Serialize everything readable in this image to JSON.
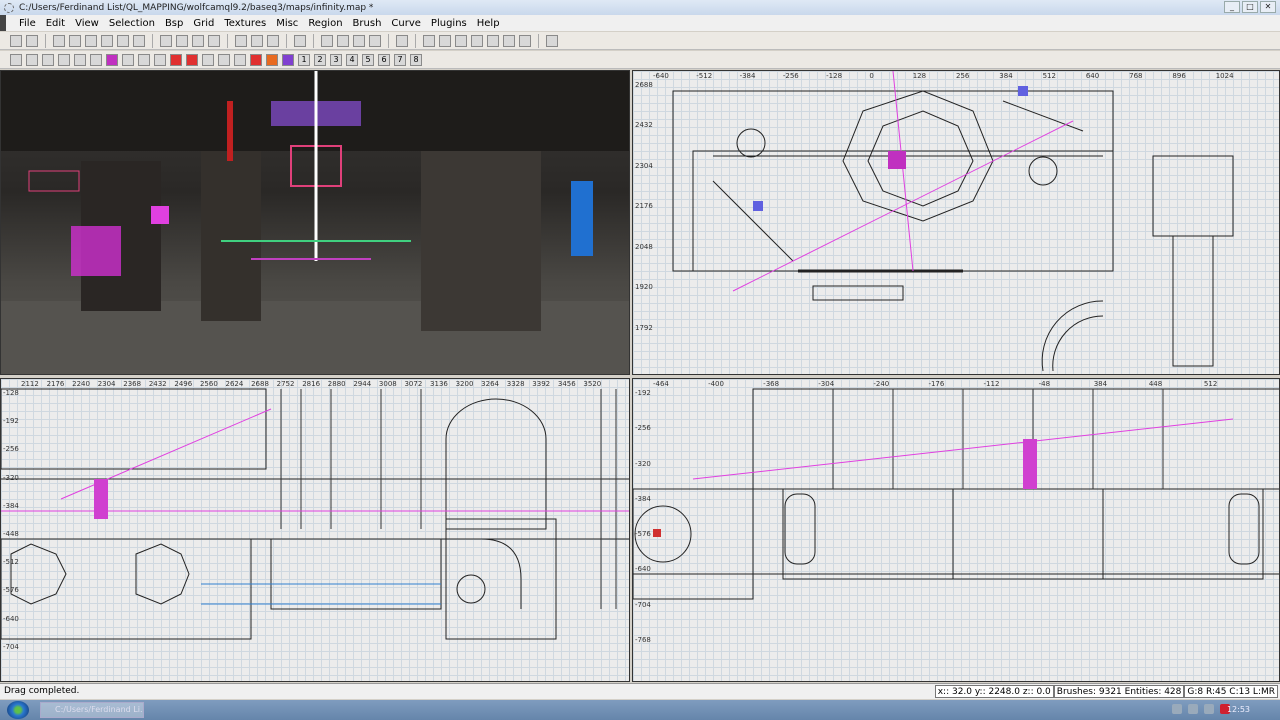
{
  "window": {
    "title": "C:/Users/Ferdinand List/QL_MAPPING/wolfcamql9.2/baseq3/maps/infinity.map *",
    "buttons": [
      "_",
      "□",
      "✕"
    ]
  },
  "menu": [
    "File",
    "Edit",
    "View",
    "Selection",
    "Bsp",
    "Grid",
    "Textures",
    "Misc",
    "Region",
    "Brush",
    "Curve",
    "Plugins",
    "Help"
  ],
  "toolbar1": [
    "open",
    "save",
    "|",
    "flip-x",
    "rotate-x",
    "flip-y",
    "rotate-y",
    "flip-z",
    "rotate-z",
    "|",
    "csg-subtract",
    "csg-merge",
    "hollow",
    "clipper",
    "|",
    "texture-lock",
    "camera",
    "cubic-clip",
    "|",
    "change-views",
    "|",
    "view-xy",
    "view-x",
    "view-y",
    "view-z",
    "|",
    "patch",
    "|",
    "scale",
    "rotate",
    "translate",
    "brush-1",
    "brush-2",
    "select",
    "drag",
    "|",
    "plugin"
  ],
  "toolbar2": {
    "icons": [
      "g1",
      "g2",
      "g3",
      "g4",
      "g5",
      "g6",
      "g7",
      "g8",
      "g9",
      "g10",
      "g11",
      "g12",
      "g13",
      "g14",
      "g15",
      "g16",
      "g17",
      "g18"
    ],
    "grid_sizes": [
      "1",
      "2",
      "3",
      "4",
      "5",
      "6",
      "7",
      "8"
    ]
  },
  "views": {
    "xy": {
      "xticks": [
        "-640",
        "-512",
        "-384",
        "-256",
        "-128",
        "0",
        "128",
        "256",
        "384",
        "512",
        "640",
        "768",
        "896",
        "1024"
      ],
      "yticks": [
        "2688",
        "2432",
        "2304",
        "2176",
        "2048",
        "1920",
        "1792"
      ]
    },
    "xz": {
      "xticks": [
        "2112",
        "2176",
        "2240",
        "2304",
        "2368",
        "2432",
        "2496",
        "2560",
        "2624",
        "2688",
        "2752",
        "2816",
        "2880",
        "2944",
        "3008",
        "3072",
        "3136",
        "3200",
        "3264",
        "3328",
        "3392",
        "3456",
        "3520"
      ],
      "yticks": [
        "-128",
        "-192",
        "-256",
        "-320",
        "-384",
        "-448",
        "-512",
        "-576",
        "-640",
        "-704"
      ]
    },
    "yz": {
      "xticks": [
        "-464",
        "-400",
        "-368",
        "-304",
        "-240",
        "-176",
        "-112",
        "-48",
        "384",
        "448",
        "512"
      ],
      "yticks": [
        "-192",
        "-256",
        "-320",
        "-384",
        "-576",
        "-640",
        "-704",
        "-768"
      ]
    }
  },
  "status": {
    "message": "Drag completed.",
    "coords": "x:: 32.0  y:: 2248.0  z:: 0.0",
    "counts": "Brushes: 9321 Entities: 428",
    "grid": "G:8 R:45 C:13 L:MR"
  },
  "taskbar": {
    "item": "C:/Users/Ferdinand Li...",
    "clock": "12:53"
  }
}
